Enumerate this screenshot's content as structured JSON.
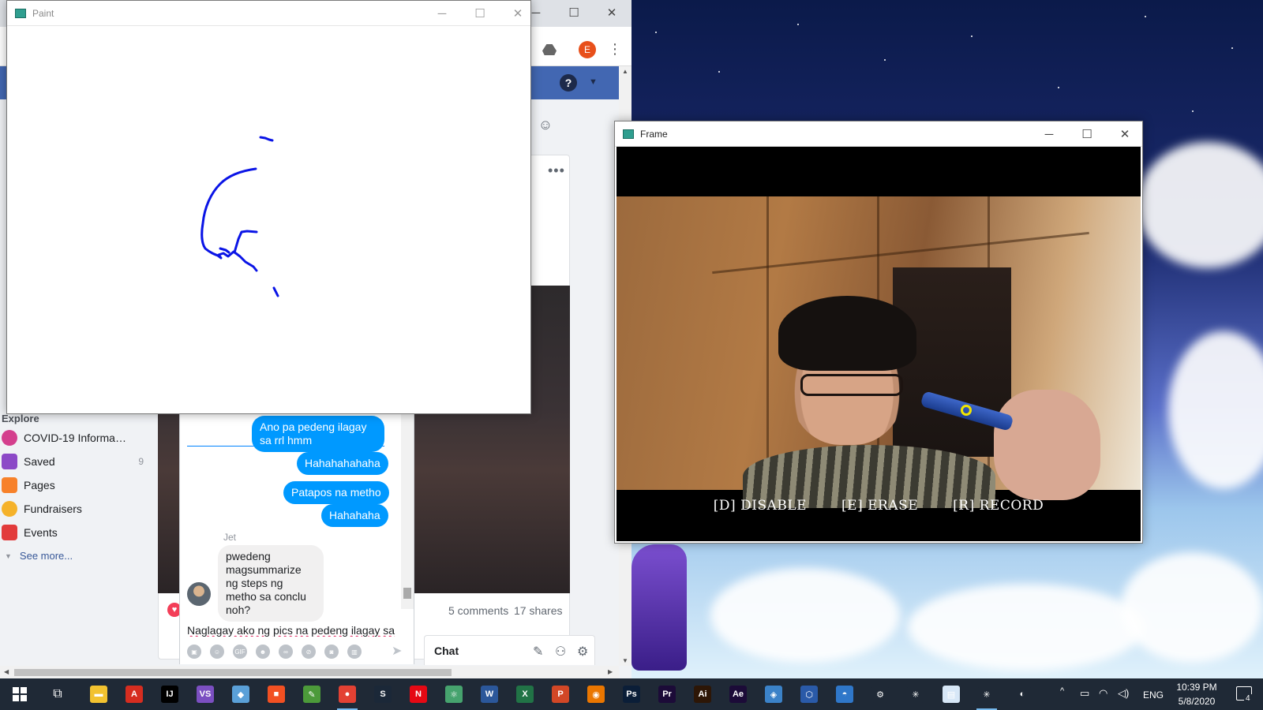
{
  "paint": {
    "title": "Paint"
  },
  "frame": {
    "title": "Frame",
    "instructions": [
      "[D] DISABLE",
      "[E] ERASE",
      "[R] RECORD"
    ]
  },
  "chrome": {
    "account_initial": "E"
  },
  "facebook": {
    "explore_label": "Explore",
    "nav_items": [
      {
        "label": "COVID-19 Informat...",
        "icon": "shield-heart-icon",
        "color": "#d43f8d",
        "count": ""
      },
      {
        "label": "Saved",
        "icon": "bookmark-icon",
        "color": "#8c49c7",
        "count": "9"
      },
      {
        "label": "Pages",
        "icon": "flag-icon",
        "color": "#f7812a",
        "count": ""
      },
      {
        "label": "Fundraisers",
        "icon": "heart-coin-icon",
        "color": "#f5b22a",
        "count": ""
      },
      {
        "label": "Events",
        "icon": "calendar-icon",
        "color": "#e23b3b",
        "count": ""
      }
    ],
    "see_more": "See more...",
    "post": {
      "comments": "5 comments",
      "shares": "17 shares"
    },
    "chat_bar_label": "Chat"
  },
  "messenger": {
    "messages_out": [
      "Ano pa pedeng ilagay sa rrl hmm",
      "Hahahahahaha",
      "Patapos na metho",
      "Hahahaha"
    ],
    "sender": "Jet",
    "message_in": "pwedeng magsummarize ng steps ng metho sa conclu noh?",
    "composer_text": "Naglagay ako ng pics na pedeng ilagay sa",
    "accent_color": "#0099ff"
  },
  "taskbar": {
    "apps": [
      {
        "name": "file-explorer-icon",
        "color": "#f2c230",
        "glyph": "▬"
      },
      {
        "name": "acrobat-icon",
        "color": "#d62d20",
        "glyph": "A"
      },
      {
        "name": "intellij-icon",
        "color": "#000000",
        "glyph": "IJ"
      },
      {
        "name": "visual-studio-icon",
        "color": "#7b4fc1",
        "glyph": "VS"
      },
      {
        "name": "cube-app-icon",
        "color": "#5aa0d8",
        "glyph": "◆"
      },
      {
        "name": "microsoft-icon",
        "color": "#f25022",
        "glyph": "■"
      },
      {
        "name": "notepad-icon",
        "color": "#4c9a3a",
        "glyph": "✎"
      },
      {
        "name": "chrome-icon",
        "color": "#e34133",
        "glyph": "●"
      },
      {
        "name": "steam-icon",
        "color": "#1b2838",
        "glyph": "S"
      },
      {
        "name": "netflix-icon",
        "color": "#e50914",
        "glyph": "N"
      },
      {
        "name": "atom-icon",
        "color": "#46a36e",
        "glyph": "⚛"
      },
      {
        "name": "word-icon",
        "color": "#2b579a",
        "glyph": "W"
      },
      {
        "name": "excel-icon",
        "color": "#217346",
        "glyph": "X"
      },
      {
        "name": "powerpoint-icon",
        "color": "#d24726",
        "glyph": "P"
      },
      {
        "name": "blender-icon",
        "color": "#ea7600",
        "glyph": "◉"
      },
      {
        "name": "photoshop-icon",
        "color": "#0b1e38",
        "glyph": "Ps"
      },
      {
        "name": "premiere-icon",
        "color": "#1c0b38",
        "glyph": "Pr"
      },
      {
        "name": "illustrator-icon",
        "color": "#2d1606",
        "glyph": "Ai"
      },
      {
        "name": "after-effects-icon",
        "color": "#1c0b38",
        "glyph": "Ae"
      },
      {
        "name": "git-icon",
        "color": "#3b82c8",
        "glyph": "◈"
      },
      {
        "name": "virtualbox-icon",
        "color": "#2a5aa8",
        "glyph": "⬡"
      },
      {
        "name": "dropbox-icon",
        "color": "#2f77c9",
        "glyph": "◓"
      },
      {
        "name": "settings-icon",
        "color": "#1f2936",
        "glyph": "⚙"
      },
      {
        "name": "spider-app-icon",
        "color": "#1f2936",
        "glyph": "✳"
      },
      {
        "name": "document-app-icon",
        "color": "#d7e7f7",
        "glyph": "▤"
      },
      {
        "name": "python-frame-icon",
        "color": "#1f2936",
        "glyph": "✳"
      },
      {
        "name": "photos-icon",
        "color": "#1f2936",
        "glyph": "◐"
      }
    ],
    "language": "ENG",
    "time": "10:39 PM",
    "date": "5/8/2020",
    "notification_count": "4"
  }
}
